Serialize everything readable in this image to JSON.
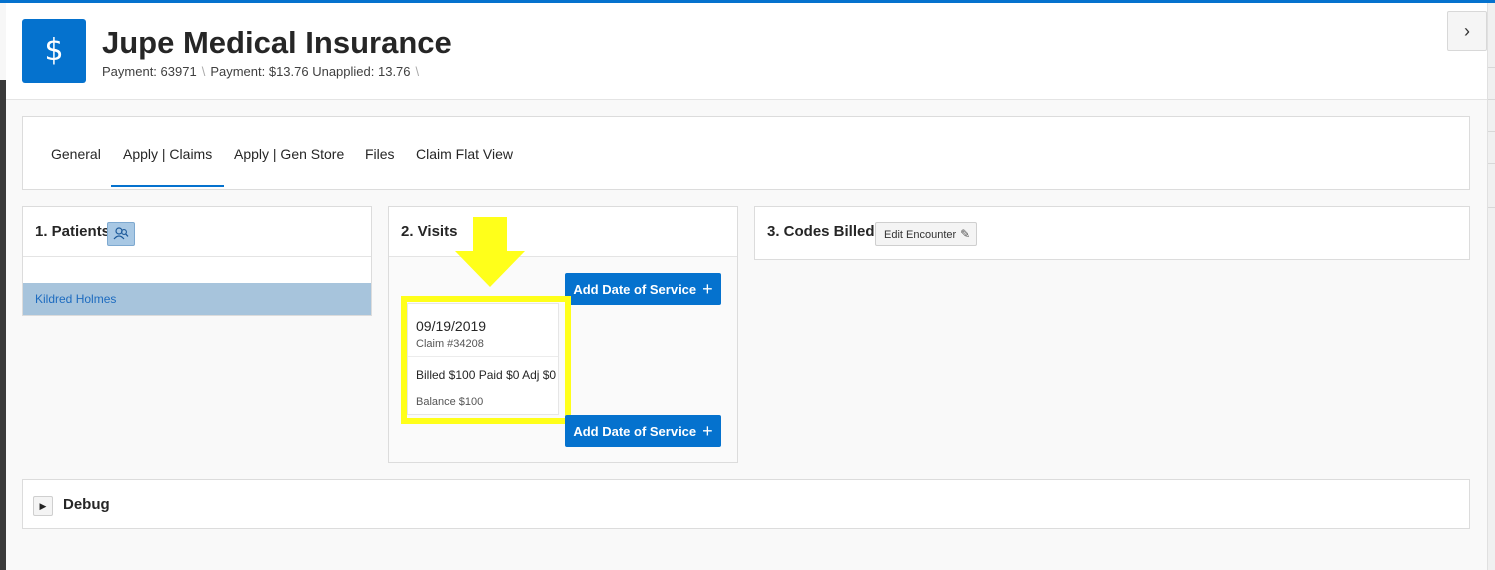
{
  "header": {
    "icon": "dollar-icon",
    "icon_glyph": "$",
    "title": "Jupe Medical Insurance",
    "breadcrumbs": [
      "Payment: 63971",
      "Payment: $13.76 Unapplied: 13.76"
    ],
    "separator": "\\",
    "collapse_glyph": "›"
  },
  "tabs": [
    {
      "label": "General",
      "active": false
    },
    {
      "label": "Apply | Claims",
      "active": true
    },
    {
      "label": "Apply | Gen Store",
      "active": false
    },
    {
      "label": "Files",
      "active": false
    },
    {
      "label": "Claim Flat View",
      "active": false
    }
  ],
  "patients": {
    "title": "1. Patients",
    "search_icon": "people-search-icon",
    "items": [
      "Kildred Holmes"
    ]
  },
  "visits": {
    "title": "2. Visits",
    "add_button_label": "Add Date of Service",
    "add_button_icon": "+",
    "cards": [
      {
        "date": "09/19/2019",
        "claim": "Claim #34208",
        "amounts": "Billed $100 Paid $0 Adj $0",
        "balance": "Balance $100"
      }
    ]
  },
  "codes": {
    "title": "3. Codes Billed",
    "edit_button_label": "Edit Encounter",
    "edit_icon": "✎"
  },
  "debug": {
    "title": "Debug",
    "toggle_glyph": "▶"
  },
  "colors": {
    "accent": "#0572ce",
    "highlight": "#ffff1a",
    "selected_row": "#a7c4dc"
  }
}
